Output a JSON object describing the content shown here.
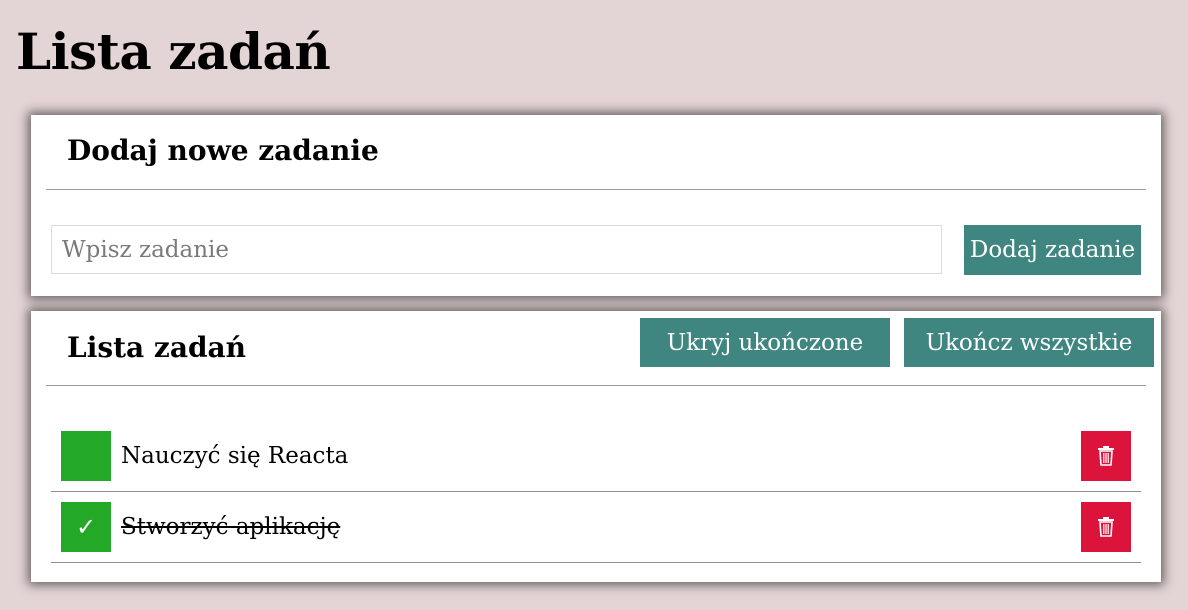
{
  "page": {
    "title": "Lista zadań"
  },
  "add_section": {
    "heading": "Dodaj nowe zadanie",
    "input_placeholder": "Wpisz zadanie",
    "input_value": "",
    "add_button_label": "Dodaj zadanie"
  },
  "list_section": {
    "heading": "Lista zadań",
    "hide_done_button_label": "Ukryj ukończone",
    "finish_all_button_label": "Ukończ wszystkie",
    "tasks": [
      {
        "text": "Nauczyć się Reacta",
        "done": false,
        "check_mark": ""
      },
      {
        "text": "Stworzyć aplikację",
        "done": true,
        "check_mark": "✓"
      }
    ]
  },
  "icons": {
    "delete": "trash-icon",
    "done": "checkmark-icon"
  },
  "colors": {
    "background": "#e3d4d5",
    "primary_button": "#3f8580",
    "done_toggle": "#23a827",
    "delete_button": "#dc143c"
  }
}
